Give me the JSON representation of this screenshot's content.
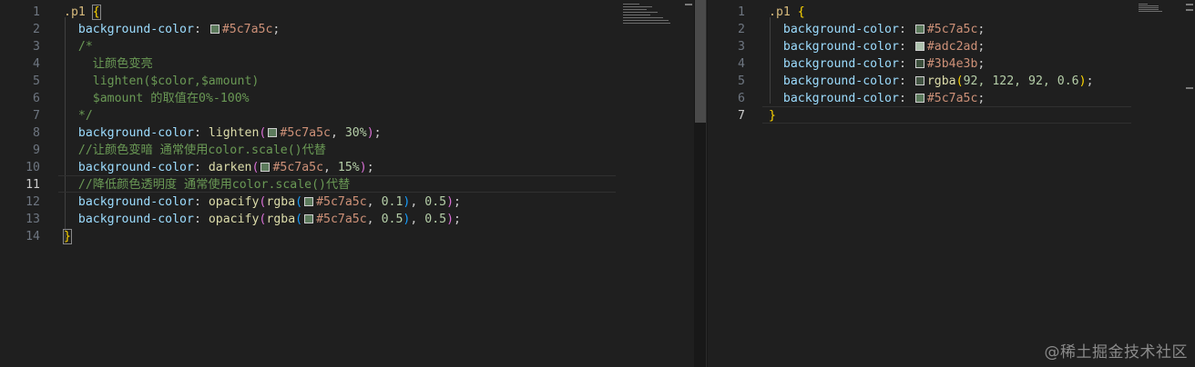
{
  "left_editor": {
    "line_numbers": [
      "1",
      "2",
      "3",
      "4",
      "5",
      "6",
      "7",
      "8",
      "9",
      "10",
      "11",
      "12",
      "13",
      "14"
    ],
    "active_line": "11",
    "lines": [
      ".p1 {",
      "  background-color: #5c7a5c;",
      "  /*",
      "    让颜色变亮",
      "    lighten($color,$amount)",
      "    $amount 的取值在0%-100%",
      "  */",
      "  background-color: lighten(#5c7a5c, 30%);",
      "  //让颜色变暗 通常使用color.scale()代替",
      "  background-color: darken(#5c7a5c, 15%);",
      "  //降低颜色透明度 通常使用color.scale()代替",
      "  background-color: opacify(rgba(#5c7a5c, 0.1), 0.5);",
      "  background-color: opacify(rgba(#5c7a5c, 0.5), 0.5);",
      "}"
    ]
  },
  "right_editor": {
    "line_numbers": [
      "1",
      "2",
      "3",
      "4",
      "5",
      "6",
      "7"
    ],
    "active_line": "7",
    "lines": [
      ".p1 {",
      "  background-color: #5c7a5c;",
      "  background-color: #adc2ad;",
      "  background-color: #3b4e3b;",
      "  background-color: rgba(92, 122, 92, 0.6);",
      "  background-color: #5c7a5c;",
      "}"
    ]
  },
  "tokens": {
    "selector": ".p1",
    "open_brace": "{",
    "close_brace": "}",
    "prop": "background-color",
    "colon": ":",
    "semi": ";",
    "comma": ",",
    "lparen": "(",
    "rparen": ")",
    "hex_base": "#5c7a5c",
    "comment_open": "/*",
    "comment_close": "*/",
    "comment_line_1": "让颜色变亮",
    "comment_line_2": "lighten($color,$amount)",
    "comment_line_3": "$amount 的取值在0%-100%",
    "fn_lighten": "lighten",
    "fn_darken": "darken",
    "fn_opacify": "opacify",
    "fn_rgba": "rgba",
    "num_30": "30%",
    "num_15": "15%",
    "num_01": "0.1",
    "num_05": "0.5",
    "line_comment_darken": "//让颜色变暗 通常使用color.scale()代替",
    "line_comment_opacify": "//降低颜色透明度 通常使用color.scale()代替",
    "out_hex_2": "#5c7a5c",
    "out_hex_3": "#adc2ad",
    "out_hex_4": "#3b4e3b",
    "out_rgba_args": "92, 122, 92, 0.6",
    "out_hex_6": "#5c7a5c"
  },
  "swatch_colors": {
    "base": "#5c7a5c",
    "light": "#adc2ad",
    "dark": "#3b4e3b",
    "rgba": "rgba(92, 122, 92, 0.6)"
  },
  "watermark": "@稀土掘金技术社区"
}
